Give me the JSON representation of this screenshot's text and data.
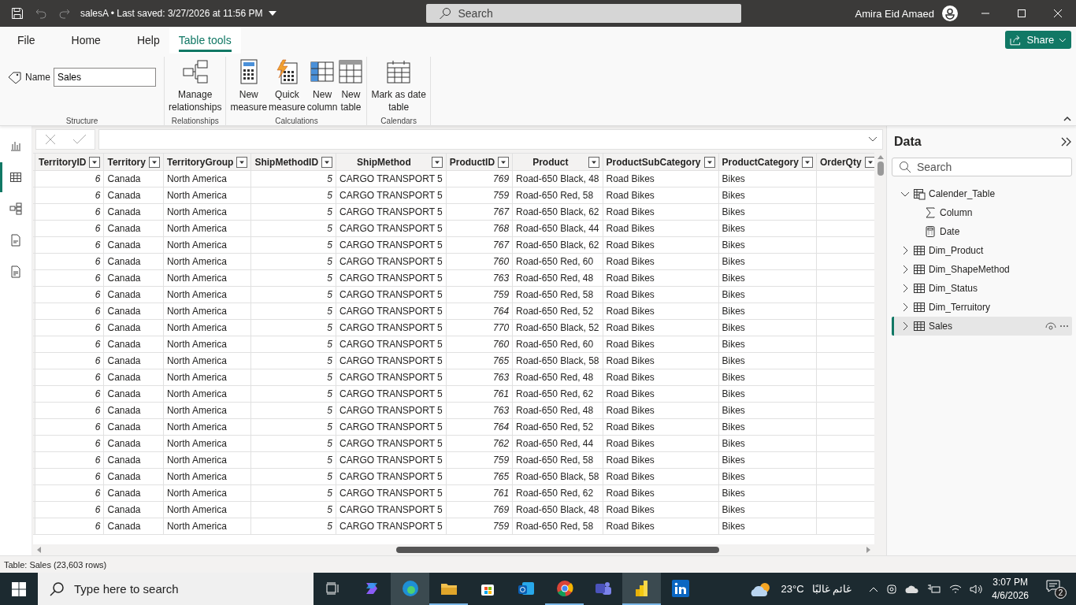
{
  "title_bar": {
    "file": "salesA • Last saved: 3/27/2026 at 11:56 PM",
    "search": {
      "placeholder": "Search"
    },
    "user": "Amira Eid Amaed"
  },
  "ribbon": {
    "tabs": [
      {
        "label": "File",
        "selected": false
      },
      {
        "label": "Home",
        "selected": false
      },
      {
        "label": "Help",
        "selected": false
      },
      {
        "label": "Table tools",
        "selected": true
      }
    ],
    "share": "Share",
    "groups": [
      {
        "label": "Structure",
        "name_field": {
          "label": "Name",
          "value": "Sales"
        }
      },
      {
        "label": "Relationships",
        "buttons": [
          {
            "kind": "relationships",
            "lines": [
              "Manage",
              "relationships"
            ]
          }
        ]
      },
      {
        "label": "Calculations",
        "buttons": [
          {
            "kind": "measure",
            "lines": [
              "New",
              "measure"
            ]
          },
          {
            "kind": "quick",
            "lines": [
              "Quick",
              "measure"
            ]
          },
          {
            "kind": "column",
            "lines": [
              "New",
              "column"
            ]
          },
          {
            "kind": "table",
            "lines": [
              "New",
              "table"
            ]
          }
        ]
      },
      {
        "label": "Calendars",
        "buttons": [
          {
            "kind": "calendar",
            "lines": [
              "Mark as date",
              "table"
            ]
          }
        ]
      }
    ]
  },
  "left_nav": [
    {
      "kind": "report",
      "selected": false
    },
    {
      "kind": "table",
      "selected": true
    },
    {
      "kind": "model",
      "selected": false
    },
    {
      "kind": "dax",
      "selected": false
    },
    {
      "kind": "tmdl",
      "selected": false
    }
  ],
  "table": {
    "columns": [
      {
        "label": "TerritoryID",
        "kind": "number"
      },
      {
        "label": "Territory",
        "kind": "text"
      },
      {
        "label": "TerritoryGroup",
        "kind": "text"
      },
      {
        "label": "ShipMethodID",
        "kind": "number"
      },
      {
        "label": "ShipMethod",
        "kind": "text"
      },
      {
        "label": "ProductID",
        "kind": "number"
      },
      {
        "label": "Product",
        "kind": "text"
      },
      {
        "label": "ProductSubCategory",
        "kind": "text"
      },
      {
        "label": "ProductCategory",
        "kind": "text"
      },
      {
        "label": "OrderQty",
        "kind": "number"
      }
    ],
    "rows": [
      [
        "6",
        "Canada",
        "North America",
        "5",
        "CARGO TRANSPORT 5",
        "769",
        "Road-650 Black, 48",
        "Road Bikes",
        "Bikes"
      ],
      [
        "6",
        "Canada",
        "North America",
        "5",
        "CARGO TRANSPORT 5",
        "759",
        "Road-650 Red, 58",
        "Road Bikes",
        "Bikes"
      ],
      [
        "6",
        "Canada",
        "North America",
        "5",
        "CARGO TRANSPORT 5",
        "767",
        "Road-650 Black, 62",
        "Road Bikes",
        "Bikes"
      ],
      [
        "6",
        "Canada",
        "North America",
        "5",
        "CARGO TRANSPORT 5",
        "768",
        "Road-650 Black, 44",
        "Road Bikes",
        "Bikes"
      ],
      [
        "6",
        "Canada",
        "North America",
        "5",
        "CARGO TRANSPORT 5",
        "767",
        "Road-650 Black, 62",
        "Road Bikes",
        "Bikes"
      ],
      [
        "6",
        "Canada",
        "North America",
        "5",
        "CARGO TRANSPORT 5",
        "760",
        "Road-650 Red, 60",
        "Road Bikes",
        "Bikes"
      ],
      [
        "6",
        "Canada",
        "North America",
        "5",
        "CARGO TRANSPORT 5",
        "763",
        "Road-650 Red, 48",
        "Road Bikes",
        "Bikes"
      ],
      [
        "6",
        "Canada",
        "North America",
        "5",
        "CARGO TRANSPORT 5",
        "759",
        "Road-650 Red, 58",
        "Road Bikes",
        "Bikes"
      ],
      [
        "6",
        "Canada",
        "North America",
        "5",
        "CARGO TRANSPORT 5",
        "764",
        "Road-650 Red, 52",
        "Road Bikes",
        "Bikes"
      ],
      [
        "6",
        "Canada",
        "North America",
        "5",
        "CARGO TRANSPORT 5",
        "770",
        "Road-650 Black, 52",
        "Road Bikes",
        "Bikes"
      ],
      [
        "6",
        "Canada",
        "North America",
        "5",
        "CARGO TRANSPORT 5",
        "760",
        "Road-650 Red, 60",
        "Road Bikes",
        "Bikes"
      ],
      [
        "6",
        "Canada",
        "North America",
        "5",
        "CARGO TRANSPORT 5",
        "765",
        "Road-650 Black, 58",
        "Road Bikes",
        "Bikes"
      ],
      [
        "6",
        "Canada",
        "North America",
        "5",
        "CARGO TRANSPORT 5",
        "763",
        "Road-650 Red, 48",
        "Road Bikes",
        "Bikes"
      ],
      [
        "6",
        "Canada",
        "North America",
        "5",
        "CARGO TRANSPORT 5",
        "761",
        "Road-650 Red, 62",
        "Road Bikes",
        "Bikes"
      ],
      [
        "6",
        "Canada",
        "North America",
        "5",
        "CARGO TRANSPORT 5",
        "763",
        "Road-650 Red, 48",
        "Road Bikes",
        "Bikes"
      ],
      [
        "6",
        "Canada",
        "North America",
        "5",
        "CARGO TRANSPORT 5",
        "764",
        "Road-650 Red, 52",
        "Road Bikes",
        "Bikes"
      ],
      [
        "6",
        "Canada",
        "North America",
        "5",
        "CARGO TRANSPORT 5",
        "762",
        "Road-650 Red, 44",
        "Road Bikes",
        "Bikes"
      ],
      [
        "6",
        "Canada",
        "North America",
        "5",
        "CARGO TRANSPORT 5",
        "759",
        "Road-650 Red, 58",
        "Road Bikes",
        "Bikes"
      ],
      [
        "6",
        "Canada",
        "North America",
        "5",
        "CARGO TRANSPORT 5",
        "765",
        "Road-650 Black, 58",
        "Road Bikes",
        "Bikes"
      ],
      [
        "6",
        "Canada",
        "North America",
        "5",
        "CARGO TRANSPORT 5",
        "761",
        "Road-650 Red, 62",
        "Road Bikes",
        "Bikes"
      ],
      [
        "6",
        "Canada",
        "North America",
        "5",
        "CARGO TRANSPORT 5",
        "769",
        "Road-650 Black, 48",
        "Road Bikes",
        "Bikes"
      ],
      [
        "6",
        "Canada",
        "North America",
        "5",
        "CARGO TRANSPORT 5",
        "759",
        "Road-650 Red, 58",
        "Road Bikes",
        "Bikes"
      ]
    ]
  },
  "data_pane": {
    "title": "Data",
    "search": {
      "placeholder": "Search"
    },
    "items": [
      {
        "label": "Calender_Table",
        "kind": "calc-table",
        "expanded": true,
        "selected": false,
        "children": [
          {
            "label": "Column",
            "kind": "sigma"
          },
          {
            "label": "Date",
            "kind": "calculator"
          }
        ]
      },
      {
        "label": "Dim_Product",
        "kind": "table",
        "expanded": false,
        "selected": false
      },
      {
        "label": "Dim_ShapeMethod",
        "kind": "table",
        "expanded": false,
        "selected": false
      },
      {
        "label": "Dim_Status",
        "kind": "table",
        "expanded": false,
        "selected": false
      },
      {
        "label": "Dim_Terruitory",
        "kind": "table",
        "expanded": false,
        "selected": false
      },
      {
        "label": "Sales",
        "kind": "table",
        "expanded": false,
        "selected": true
      }
    ]
  },
  "status_bar": "Table: Sales (23,603 rows)",
  "taskbar": {
    "search": {
      "placeholder": "Type here to search"
    },
    "temperature": "23°C",
    "weather": "غائم غالبًا",
    "time": "3:07 PM",
    "date": "4/6/2026",
    "notifications": "2"
  }
}
